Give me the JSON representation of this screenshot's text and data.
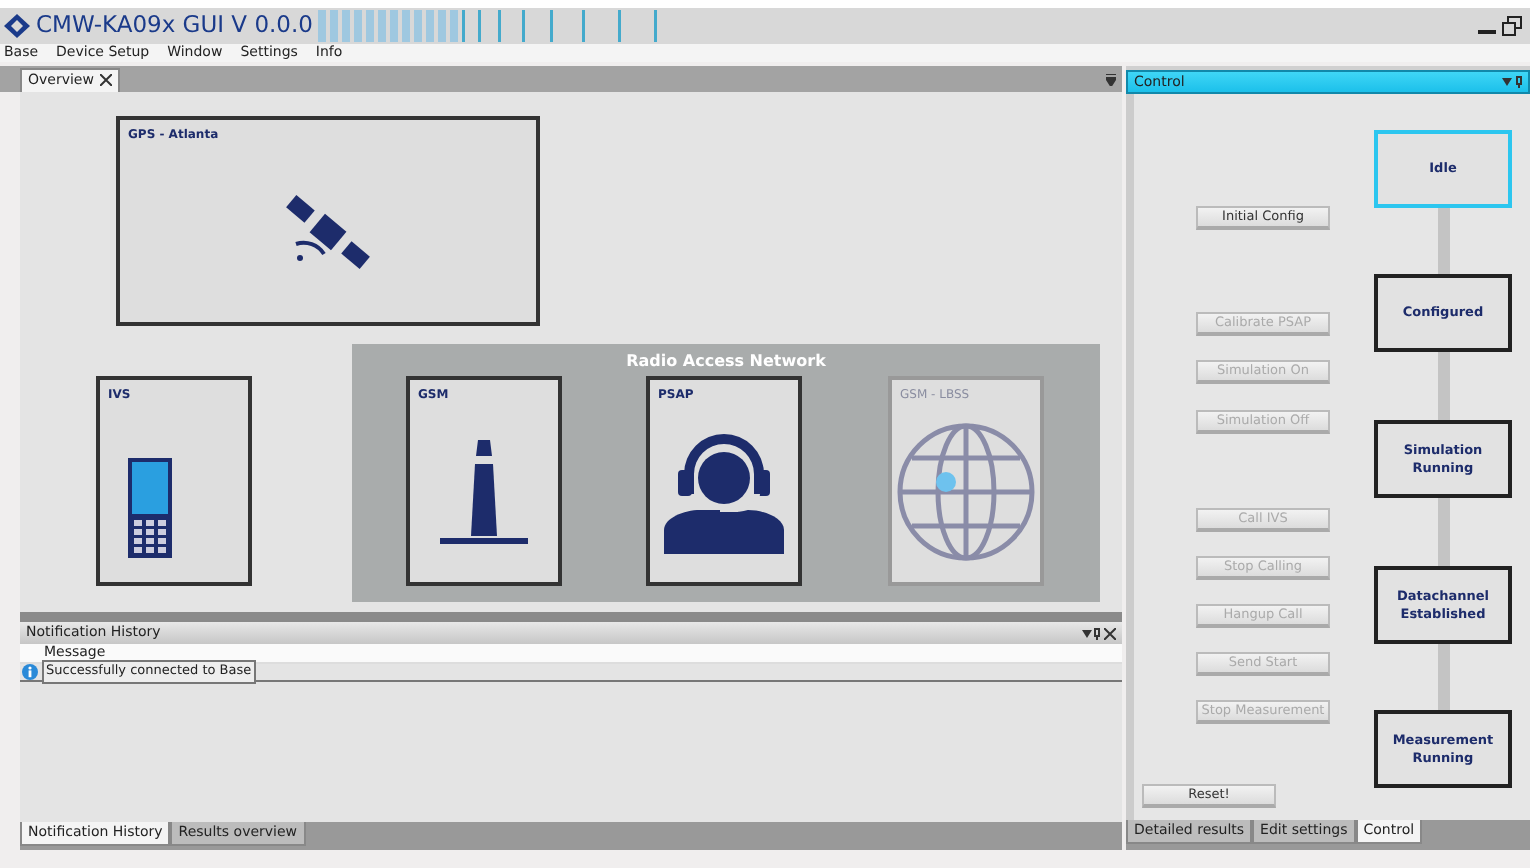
{
  "window": {
    "title": "CMW-KA09x GUI  V 0.0.0"
  },
  "menu": [
    "Base",
    "Device Setup",
    "Window",
    "Settings",
    "Info"
  ],
  "overview": {
    "tabs": [
      {
        "label": "Overview",
        "selected": true
      }
    ],
    "gps": {
      "title": "GPS - Atlanta"
    },
    "ivs": {
      "title": "IVS"
    },
    "ran": {
      "title": "Radio Access Network",
      "nodes": [
        {
          "title": "GSM",
          "kind": "tower",
          "disabled": false
        },
        {
          "title": "PSAP",
          "kind": "operator",
          "disabled": false
        },
        {
          "title": "GSM - LBSS",
          "kind": "globe",
          "disabled": true
        }
      ]
    }
  },
  "notifications": {
    "title": "Notification History",
    "columns": [
      "Message"
    ],
    "rows": [
      {
        "kind": "info",
        "message": "Successfully connected to Base"
      }
    ],
    "tabs": [
      {
        "label": "Notification History",
        "selected": true
      },
      {
        "label": "Results overview",
        "selected": false
      }
    ]
  },
  "control": {
    "title": "Control",
    "buttons": [
      {
        "label": "Initial Config",
        "disabled": false
      },
      {
        "label": "Calibrate PSAP",
        "disabled": true
      },
      {
        "label": "Simulation On",
        "disabled": true
      },
      {
        "label": "Simulation Off",
        "disabled": true
      },
      {
        "label": "Call IVS",
        "disabled": true
      },
      {
        "label": "Stop Calling",
        "disabled": true
      },
      {
        "label": "Hangup Call",
        "disabled": true
      },
      {
        "label": "Send Start",
        "disabled": true
      },
      {
        "label": "Stop Measurement",
        "disabled": true
      }
    ],
    "states": [
      {
        "label": "Idle",
        "selected": true
      },
      {
        "label": "Configured",
        "selected": false
      },
      {
        "label": "Simulation Running",
        "selected": false
      },
      {
        "label": "Datachannel Established",
        "selected": false
      },
      {
        "label": "Measurement Running",
        "selected": false
      }
    ],
    "reset": "Reset!",
    "tabs": [
      {
        "label": "Detailed results",
        "selected": false
      },
      {
        "label": "Edit settings",
        "selected": false
      },
      {
        "label": "Control",
        "selected": true
      }
    ]
  }
}
